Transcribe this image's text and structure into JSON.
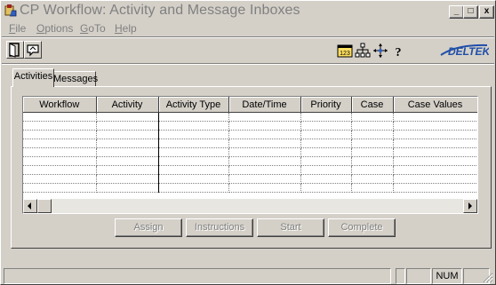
{
  "window": {
    "title": "CP Workflow: Activity and Message Inboxes",
    "controls": {
      "minimize": "_",
      "maximize": "□",
      "close": "x"
    }
  },
  "menu": {
    "items": [
      "File",
      "Options",
      "GoTo",
      "Help"
    ]
  },
  "toolbar": {
    "left": [
      "exit-door-icon",
      "mail-return-icon"
    ],
    "right": [
      "calendar-123-icon",
      "workflow-tree-icon",
      "compass-directions-icon",
      "help-question-icon"
    ],
    "logo": "DELTEK"
  },
  "tabs": [
    {
      "label": "Activities",
      "active": true
    },
    {
      "label": "Messages",
      "active": false
    }
  ],
  "grid": {
    "columns": [
      "Workflow",
      "Activity",
      "Activity Type",
      "Date/Time",
      "Priority",
      "Case",
      "Case Values"
    ],
    "row_count": 9
  },
  "actions": {
    "assign": "Assign",
    "instructions": "Instructions",
    "start": "Start",
    "complete": "Complete"
  },
  "status": {
    "num": "NUM"
  },
  "colors": {
    "disabled_text": "#808080",
    "face": "#d4d0c8",
    "logo_blue": "#1f4fa8"
  }
}
